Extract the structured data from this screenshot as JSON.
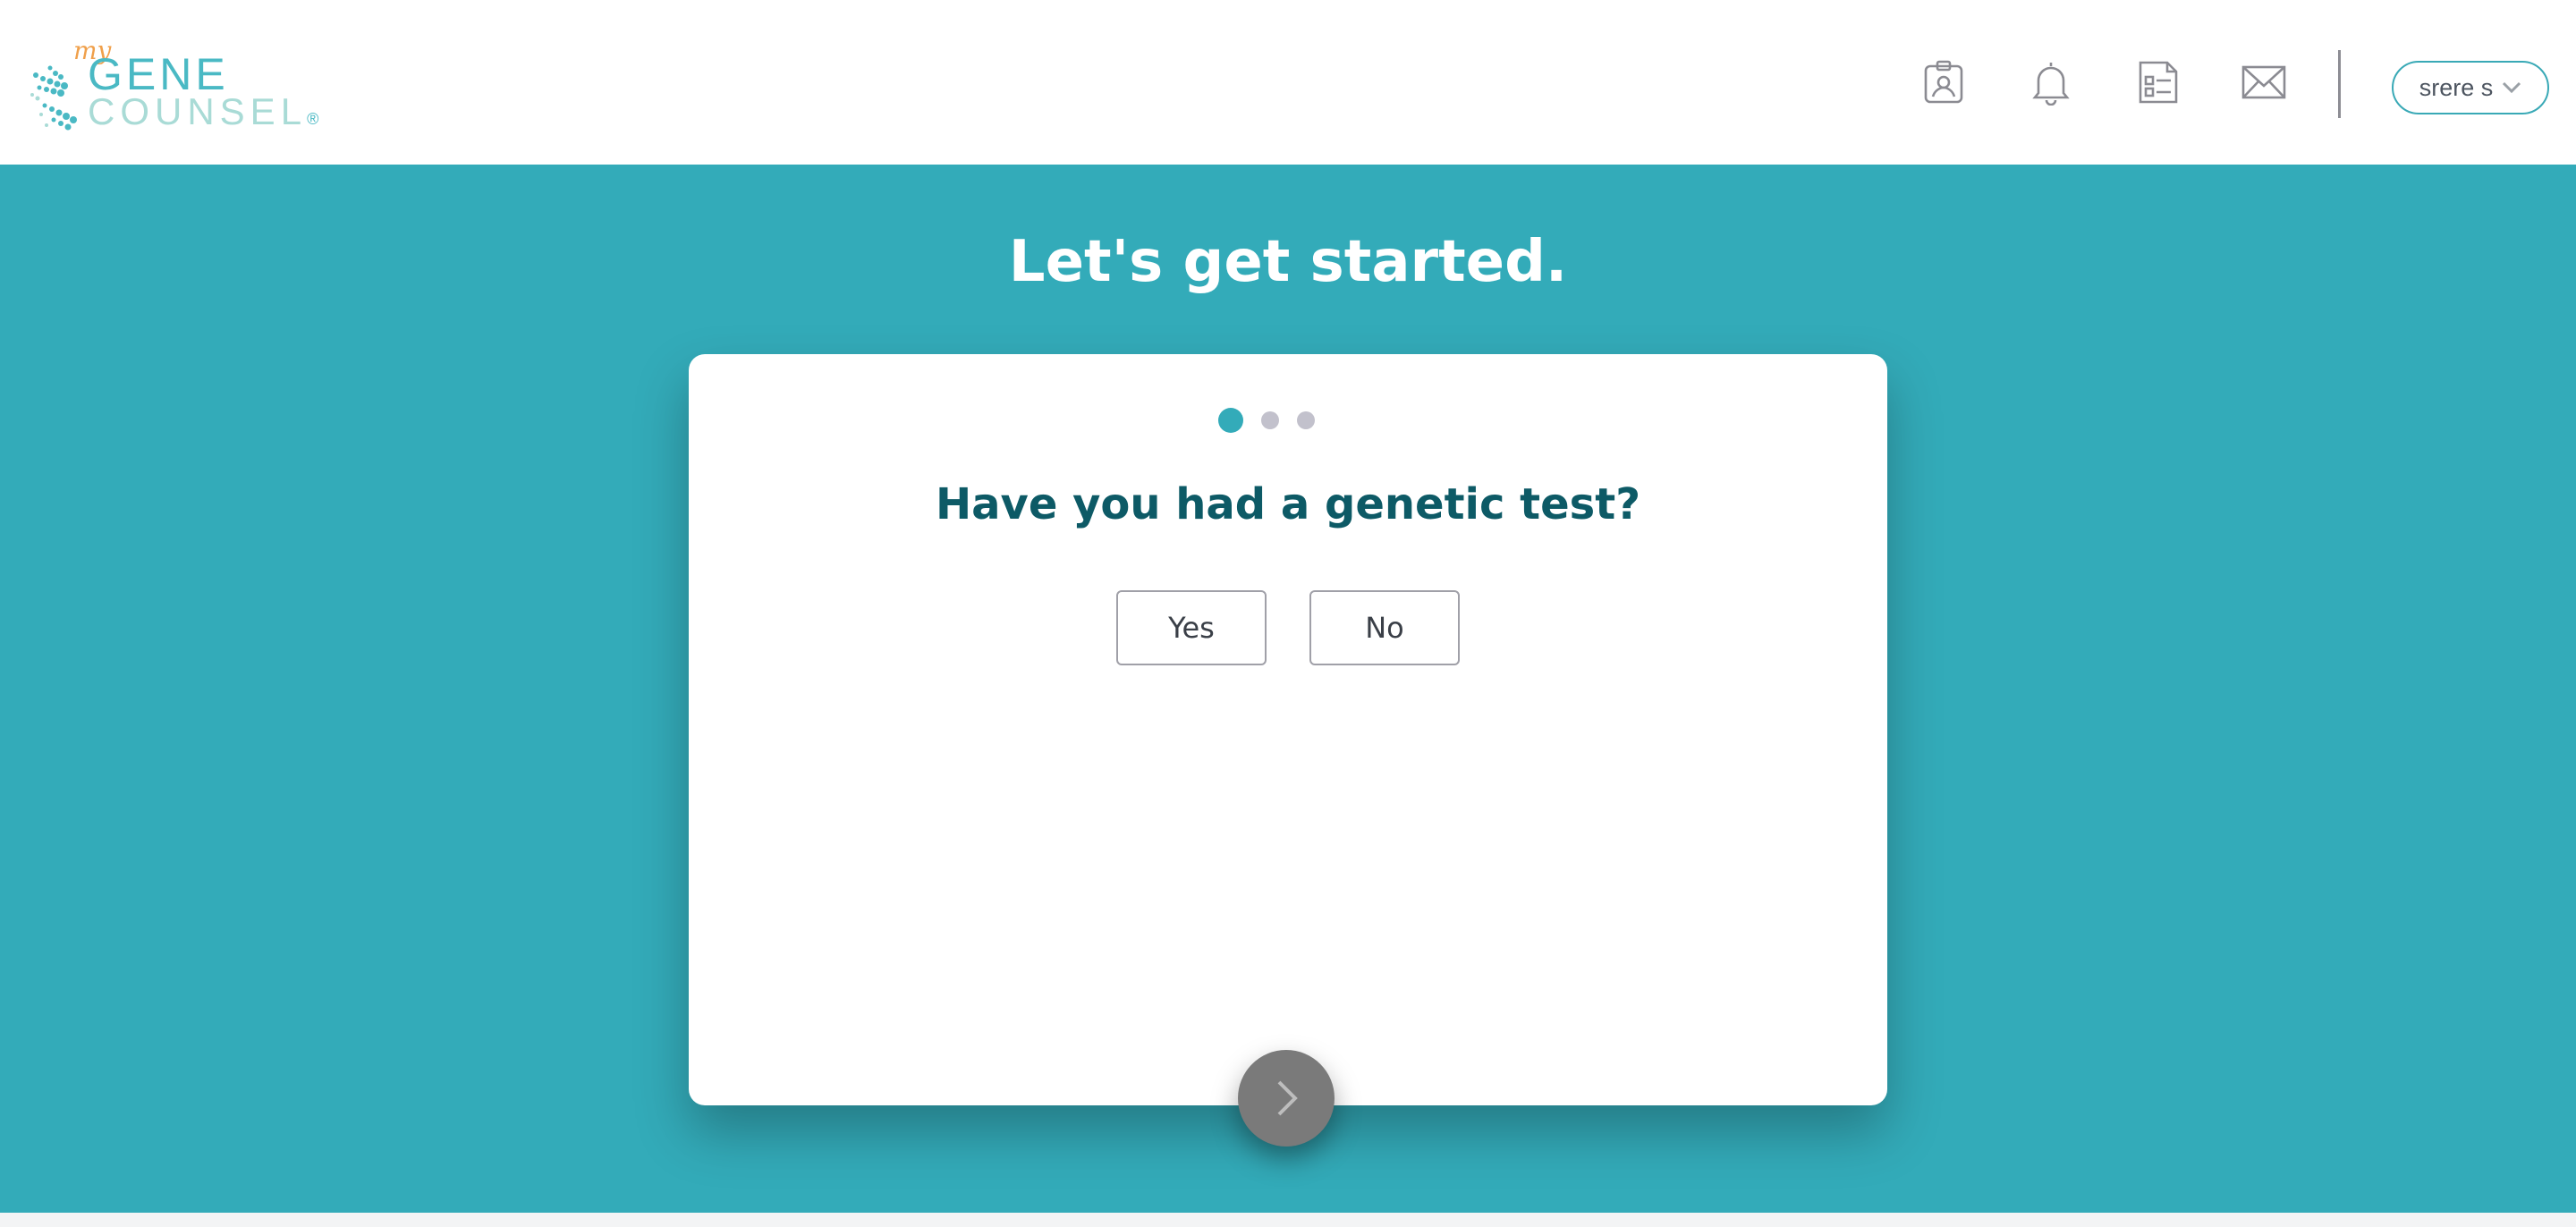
{
  "header": {
    "logo": {
      "my": "my",
      "gene": "GENE",
      "counsel": "COUNSEL",
      "registered": "®"
    },
    "icons": [
      "profile-badge-icon",
      "bell-icon",
      "checklist-document-icon",
      "mail-icon"
    ],
    "user_label": "srere s"
  },
  "main": {
    "title": "Let's get started.",
    "progress": {
      "total_steps": 3,
      "current_step": 1
    },
    "question": "Have you had a genetic test?",
    "answers": {
      "yes": "Yes",
      "no": "No"
    },
    "next_icon": "chevron-right-icon"
  },
  "colors": {
    "accent": "#33abb9",
    "question_text": "#0d5a66",
    "dot_inactive": "#c2c1cc",
    "next_button": "#7a7a7a"
  }
}
